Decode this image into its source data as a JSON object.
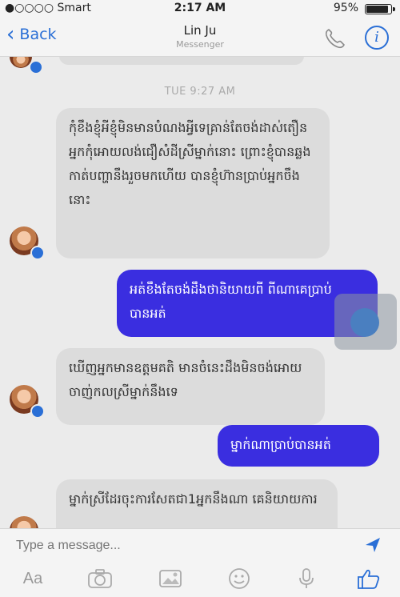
{
  "status_bar": {
    "carrier": "●○○○○ Smart",
    "time": "2:17 AM",
    "battery_text": "95%",
    "battery_level": 0.95
  },
  "nav": {
    "back_label": "Back",
    "title": "Lin Ju",
    "subtitle": "Messenger"
  },
  "conversation": {
    "timestamp": "TUE 9:27 AM",
    "messages": [
      {
        "from": "them",
        "text": "កុំខឹងខ្ញុំអីខ្ញុំមិនមានបំណងអ្វីទេគ្រាន់តែចង់ដាស់តឿនអ្នកកុំអោយលង់ជឿសំដីស្រីម្នាក់នោះ ព្រោះខ្ញុំបានឆ្លងកាត់បញ្ហានឹងរួចមកហើយ បានខ្ញុំហ៊ានប្រាប់អ្នកចឹងនោះ"
      },
      {
        "from": "me",
        "text": "អត់ខឹងតែចង់ដឹងថានិយាយពី ពីណាគេប្រាប់បានអត់"
      },
      {
        "from": "them",
        "text": "ឃើញអ្នកមានឧត្តមគតិ មានចំនេះដឹងមិនចង់អោយចាញ់កលស្រីម្នាក់នឹងទេ"
      },
      {
        "from": "me",
        "text": "ម្នាក់ណាប្រាប់បានអត់"
      },
      {
        "from": "them",
        "text": "ម្នាក់ស្រីដែរចុះការសែតជា1អ្នកនឹងណា គេនិយាយការ"
      }
    ]
  },
  "composer": {
    "placeholder": "Type a message..."
  },
  "toolbar": {
    "text_label": "Aa",
    "icons": [
      "text-format-icon",
      "camera-icon",
      "gallery-icon",
      "emoji-icon",
      "microphone-icon",
      "like-icon"
    ]
  },
  "colors": {
    "accent": "#2a6fd6",
    "outgoing_bubble": "#3a2ee0",
    "incoming_bubble": "#dcdcdc"
  }
}
